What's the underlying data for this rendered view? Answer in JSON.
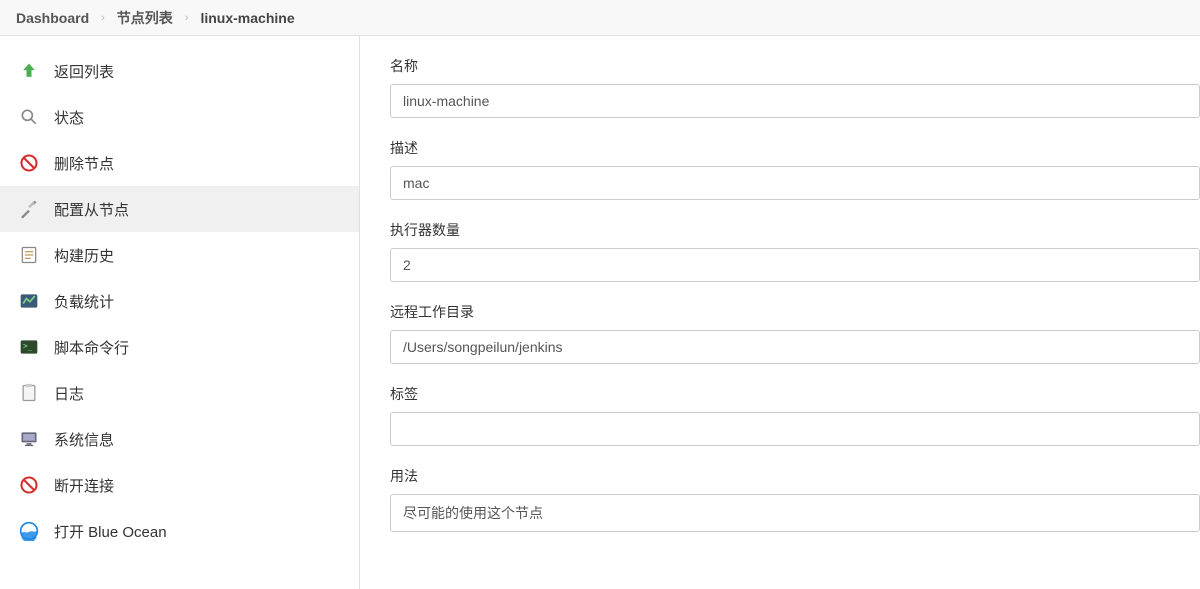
{
  "breadcrumb": {
    "items": [
      "Dashboard",
      "节点列表",
      "linux-machine"
    ]
  },
  "sidebar": {
    "items": [
      {
        "label": "返回列表",
        "icon": "arrow-up"
      },
      {
        "label": "状态",
        "icon": "magnifier"
      },
      {
        "label": "删除节点",
        "icon": "no-entry"
      },
      {
        "label": "配置从节点",
        "icon": "wrench"
      },
      {
        "label": "构建历史",
        "icon": "notepad"
      },
      {
        "label": "负载统计",
        "icon": "chart"
      },
      {
        "label": "脚本命令行",
        "icon": "terminal"
      },
      {
        "label": "日志",
        "icon": "clipboard"
      },
      {
        "label": "系统信息",
        "icon": "monitor"
      },
      {
        "label": "断开连接",
        "icon": "no-entry"
      },
      {
        "label": "打开 Blue Ocean",
        "icon": "blue-ocean"
      }
    ],
    "activeIndex": 3
  },
  "form": {
    "fields": [
      {
        "label": "名称",
        "value": "linux-machine",
        "type": "text"
      },
      {
        "label": "描述",
        "value": "mac",
        "type": "text"
      },
      {
        "label": "执行器数量",
        "value": "2",
        "type": "text"
      },
      {
        "label": "远程工作目录",
        "value": "/Users/songpeilun/jenkins",
        "type": "text"
      },
      {
        "label": "标签",
        "value": "",
        "type": "text"
      },
      {
        "label": "用法",
        "value": "尽可能的使用这个节点",
        "type": "select"
      }
    ]
  }
}
